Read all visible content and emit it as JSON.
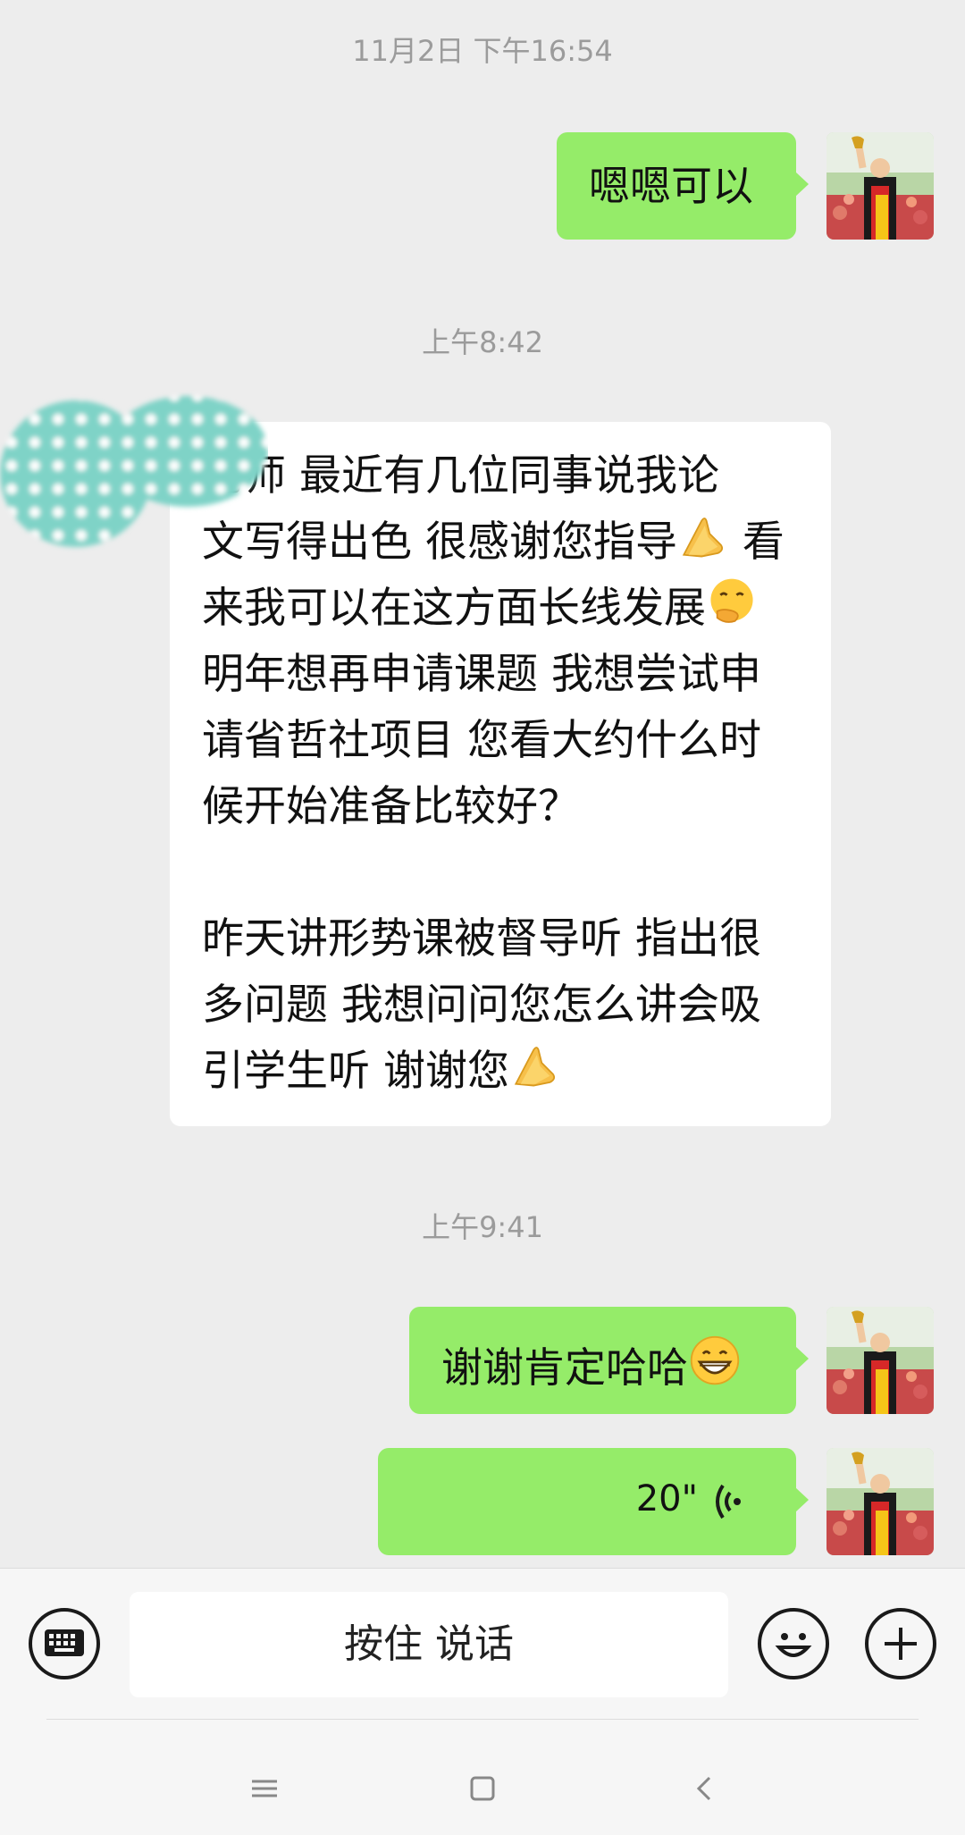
{
  "timestamps": {
    "t1": "11月2日 下午16:54",
    "t2": "上午8:42",
    "t3": "上午9:41"
  },
  "messages": {
    "m1": {
      "text": "嗯嗯可以",
      "sender": "me"
    },
    "m2": {
      "sender": "them",
      "line1": "老师 最近有几位同事说我论",
      "line2": "文写得出色 很感谢您指导",
      "line2b": " 看",
      "line3": "来我可以在这方面长线发展",
      "line4": "明年想再申请课题 我想尝试申",
      "line5": "请省哲社项目 您看大约什么时",
      "line6": "候开始准备比较好？",
      "line7": "昨天讲形势课被督导听 指出很",
      "line8": "多问题 我想问问您怎么讲会吸",
      "line9": "引学生听 谢谢您",
      "emoji_pray": "pray-emoji",
      "emoji_think": "face-with-hand-over-mouth-emoji"
    },
    "m3": {
      "text": "谢谢肯定哈哈",
      "sender": "me",
      "emoji": "grinning-face-emoji"
    },
    "m4": {
      "duration": "20\"",
      "sender": "me",
      "type": "voice"
    }
  },
  "input_bar": {
    "hold_to_talk": "按住 说话",
    "keyboard_icon": "keyboard-icon",
    "emoji_icon": "smiley-icon",
    "plus_icon": "plus-icon"
  },
  "nav": {
    "menu_icon": "menu-icon",
    "home_icon": "home-icon",
    "back_icon": "back-icon"
  },
  "colors": {
    "my_bubble": "#95ec69",
    "their_bubble": "#ffffff",
    "background": "#ededed"
  }
}
